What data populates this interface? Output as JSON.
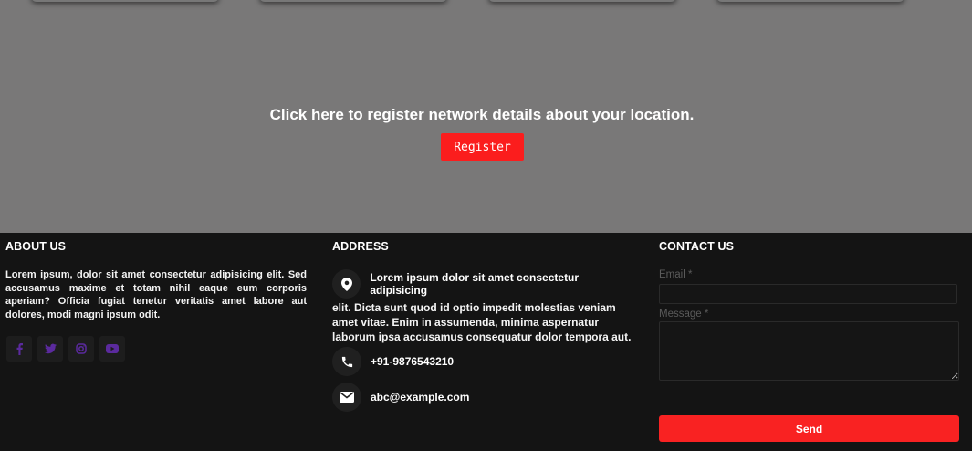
{
  "hero": {
    "message": "Click here to register network details about your location.",
    "register_label": "Register"
  },
  "colors": {
    "hero_bg": "#797878",
    "footer_bg": "#141414",
    "accent": "#fb1d1d",
    "social_icon": "#5b2a9e"
  },
  "footer": {
    "about": {
      "heading": "ABOUT US",
      "text": "Lorem ipsum, dolor sit amet consectetur adipisicing elit. Sed accusamus maxime et totam nihil eaque eum corporis aperiam? Officia fugiat tenetur veritatis amet labore aut dolores, modi magni ipsum odit.",
      "socials": [
        "facebook-icon",
        "twitter-icon",
        "instagram-icon",
        "youtube-icon"
      ]
    },
    "address": {
      "heading": "ADDRESS",
      "address_first": "Lorem ipsum dolor sit amet consectetur adipisicing",
      "address_rest": "elit. Dicta sunt quod id optio impedit molestias veniam amet vitae. Enim in assumenda, minima aspernatur laborum ipsa accusamus consequatur dolor tempora aut.",
      "phone": "+91-9876543210",
      "email": "abc@example.com"
    },
    "contact": {
      "heading": "CONTACT US",
      "email_label": "Email *",
      "email_value": "",
      "message_label": "Message *",
      "message_value": "",
      "send_label": "Send"
    }
  }
}
